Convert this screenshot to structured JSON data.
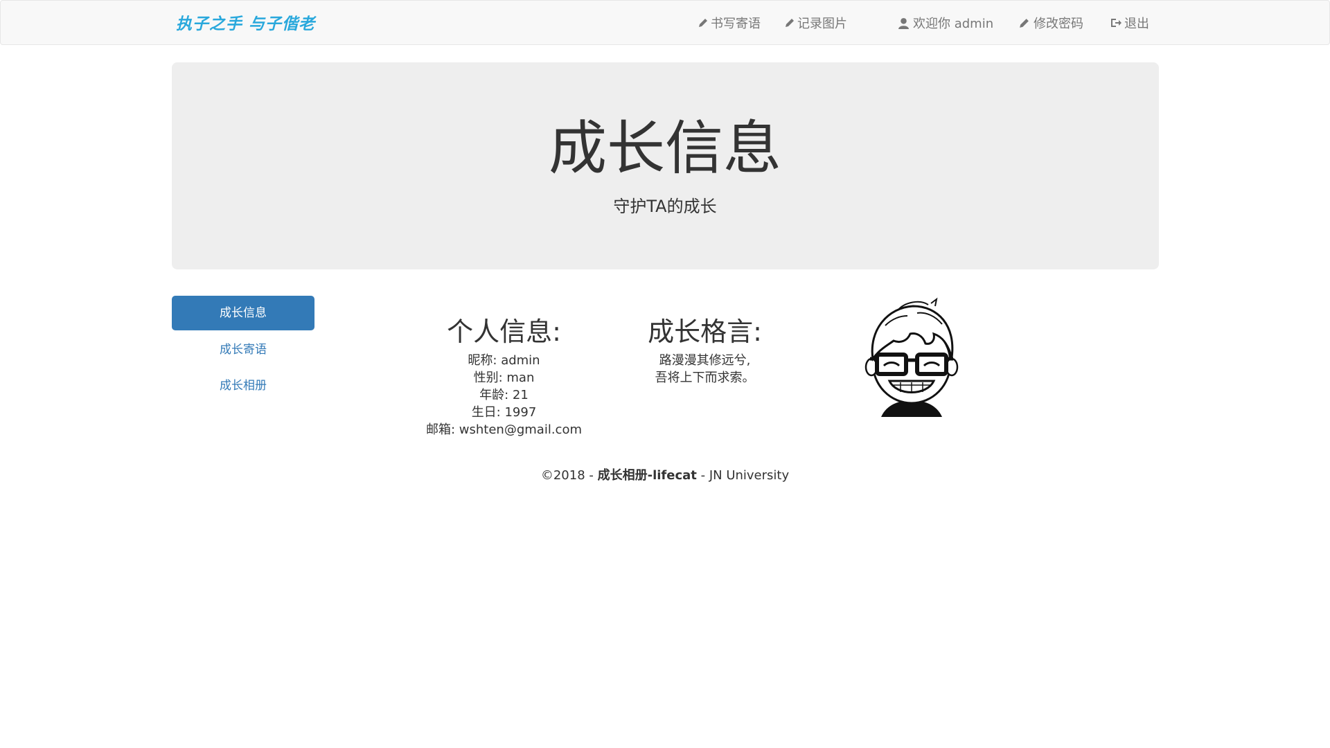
{
  "navbar": {
    "brand": "执子之手 与子偕老",
    "links": [
      {
        "label": "书写寄语",
        "icon": "pencil-icon"
      },
      {
        "label": "记录图片",
        "icon": "pencil-icon"
      },
      {
        "label": "欢迎你 admin",
        "icon": "user-icon"
      },
      {
        "label": "修改密码",
        "icon": "pencil-icon"
      },
      {
        "label": "退出",
        "icon": "logout-icon"
      }
    ]
  },
  "jumbotron": {
    "title": "成长信息",
    "subtitle": "守护TA的成长"
  },
  "sidebar": {
    "items": [
      {
        "label": "成长信息",
        "active": true
      },
      {
        "label": "成长寄语",
        "active": false
      },
      {
        "label": "成长相册",
        "active": false
      }
    ]
  },
  "profile": {
    "heading": "个人信息:",
    "lines": [
      "昵称: admin",
      "性别: man",
      "年龄: 21",
      "生日: 1997",
      "邮箱: wshten@gmail.com"
    ]
  },
  "motto": {
    "heading": "成长格言:",
    "lines": [
      "路漫漫其修远兮,",
      "吾将上下而求索。"
    ]
  },
  "avatar": {
    "icon": "cartoon-avatar-with-glasses"
  },
  "footer": {
    "prefix": "©2018 - ",
    "site": "成长相册-lifecat",
    "suffix": " - JN University"
  },
  "colors": {
    "brand": "#29a8dc",
    "primary": "#337ab7",
    "navbar_bg": "#f8f8f8",
    "jumbotron_bg": "#eeeeee"
  }
}
